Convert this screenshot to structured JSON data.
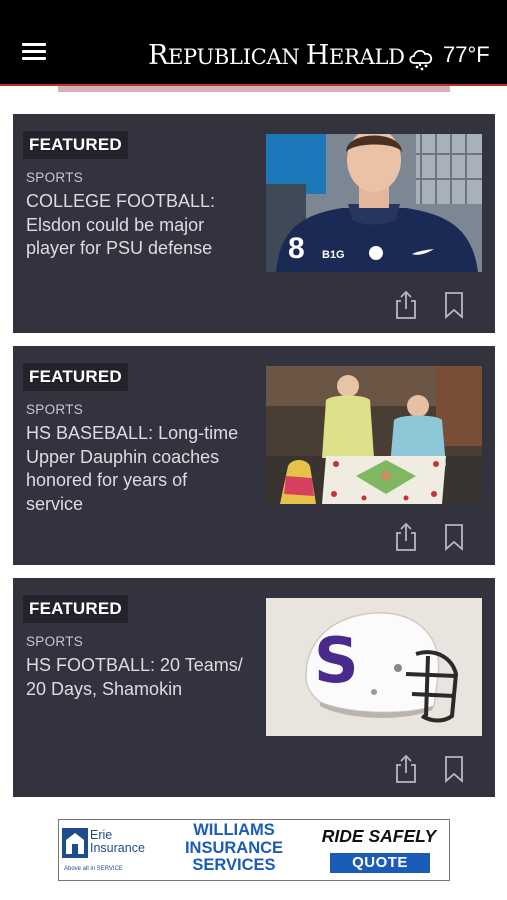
{
  "header": {
    "logo_text": "Republican Herald",
    "logo_r": "R",
    "logo_epublican": "EPUBLICAN",
    "logo_h": "H",
    "logo_erald": "ERALD",
    "weather_icon": "cloud-snow-icon",
    "temperature": "77°F",
    "menu_icon": "hamburger-menu-icon"
  },
  "articles": [
    {
      "badge": "FEATURED",
      "section": "SPORTS",
      "headline": "COLLEGE FOOTBALL: Elsdon could be major player for PSU defense",
      "thumbnail": "football-player-portrait"
    },
    {
      "badge": "FEATURED",
      "section": "SPORTS",
      "headline": "HS BASEBALL: Long-time Upper Dauphin coaches honored for years of service",
      "thumbnail": "two-coaches-with-cake"
    },
    {
      "badge": "FEATURED",
      "section": "SPORTS",
      "headline": "HS FOOTBALL: 20 Teams/ 20 Days, Shamokin",
      "thumbnail": "white-helmet-with-purple-s"
    }
  ],
  "actions": {
    "share_icon": "share-icon",
    "bookmark_icon": "bookmark-icon"
  },
  "ad": {
    "erie_line1": "Erie",
    "erie_line2": "Insurance",
    "erie_tagline": "Above all in SERVICE",
    "williams_line1": "WILLIAMS",
    "williams_line2": "INSURANCE",
    "williams_line3": "SERVICES",
    "ride_text": "RIDE SAFELY",
    "quote_label": "QUOTE"
  },
  "colors": {
    "header_bg": "#000000",
    "header_accent": "#b8322c",
    "card_bg": "#333340",
    "badge_bg": "#22222b",
    "ad_blue": "#1a5cb8"
  }
}
